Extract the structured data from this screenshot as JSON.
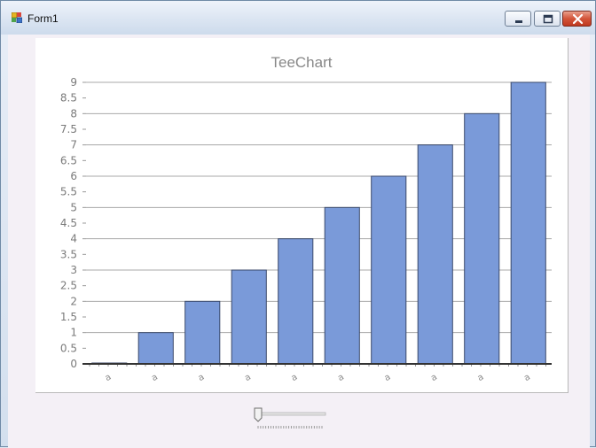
{
  "window": {
    "title": "Form1",
    "icon": "winforms-app-icon"
  },
  "title_buttons": {
    "minimize": "minimize-icon",
    "maximize": "maximize-icon",
    "close": "close-icon"
  },
  "chart_data": {
    "type": "bar",
    "title": "TeeChart",
    "categories": [
      "a",
      "a",
      "a",
      "a",
      "a",
      "a",
      "a",
      "a",
      "a",
      "a"
    ],
    "values": [
      0,
      1,
      2,
      3,
      4,
      5,
      6,
      7,
      8,
      9
    ],
    "ylim": [
      0,
      9
    ],
    "yticks": [
      "0",
      "0.5",
      "1",
      "1.5",
      "2",
      "2.5",
      "3",
      "3.5",
      "4",
      "4.5",
      "5",
      "5.5",
      "6",
      "6.5",
      "7",
      "7.5",
      "8",
      "8.5",
      "9"
    ],
    "grid": true,
    "legend": "none",
    "bar_color": "#7a9ad9",
    "bar_border": "#3b4a6b"
  },
  "slider": {
    "value": 0,
    "min": 0,
    "max": 100
  }
}
